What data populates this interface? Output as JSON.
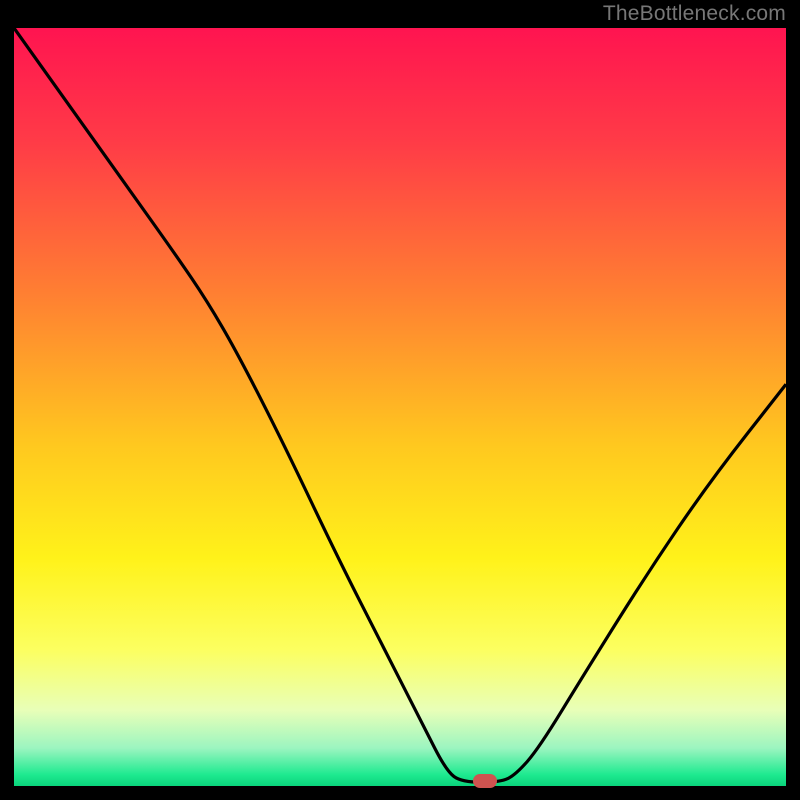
{
  "attribution": "TheBottleneck.com",
  "chart_data": {
    "type": "line",
    "title": "",
    "xlabel": "",
    "ylabel": "",
    "xlim": [
      0,
      100
    ],
    "ylim": [
      0,
      100
    ],
    "curve_points": [
      {
        "x": 0,
        "y": 100
      },
      {
        "x": 7,
        "y": 90
      },
      {
        "x": 14,
        "y": 80
      },
      {
        "x": 21,
        "y": 70
      },
      {
        "x": 25,
        "y": 64
      },
      {
        "x": 29,
        "y": 57
      },
      {
        "x": 35,
        "y": 45
      },
      {
        "x": 42,
        "y": 30
      },
      {
        "x": 48,
        "y": 18
      },
      {
        "x": 53,
        "y": 8
      },
      {
        "x": 56,
        "y": 2
      },
      {
        "x": 58,
        "y": 0.5
      },
      {
        "x": 63,
        "y": 0.5
      },
      {
        "x": 65,
        "y": 1.5
      },
      {
        "x": 68,
        "y": 5
      },
      {
        "x": 74,
        "y": 15
      },
      {
        "x": 82,
        "y": 28
      },
      {
        "x": 90,
        "y": 40
      },
      {
        "x": 100,
        "y": 53
      }
    ],
    "marker": {
      "x": 61,
      "y": 0.7
    },
    "gradient_stops": [
      {
        "offset": 0,
        "color": "#ff1450"
      },
      {
        "offset": 15,
        "color": "#ff3b47"
      },
      {
        "offset": 35,
        "color": "#ff7f32"
      },
      {
        "offset": 55,
        "color": "#ffc81f"
      },
      {
        "offset": 70,
        "color": "#fff21a"
      },
      {
        "offset": 82,
        "color": "#fcff60"
      },
      {
        "offset": 90,
        "color": "#e8ffb8"
      },
      {
        "offset": 95,
        "color": "#9cf5c0"
      },
      {
        "offset": 98.5,
        "color": "#1eea90"
      },
      {
        "offset": 100,
        "color": "#0ad37b"
      }
    ]
  }
}
